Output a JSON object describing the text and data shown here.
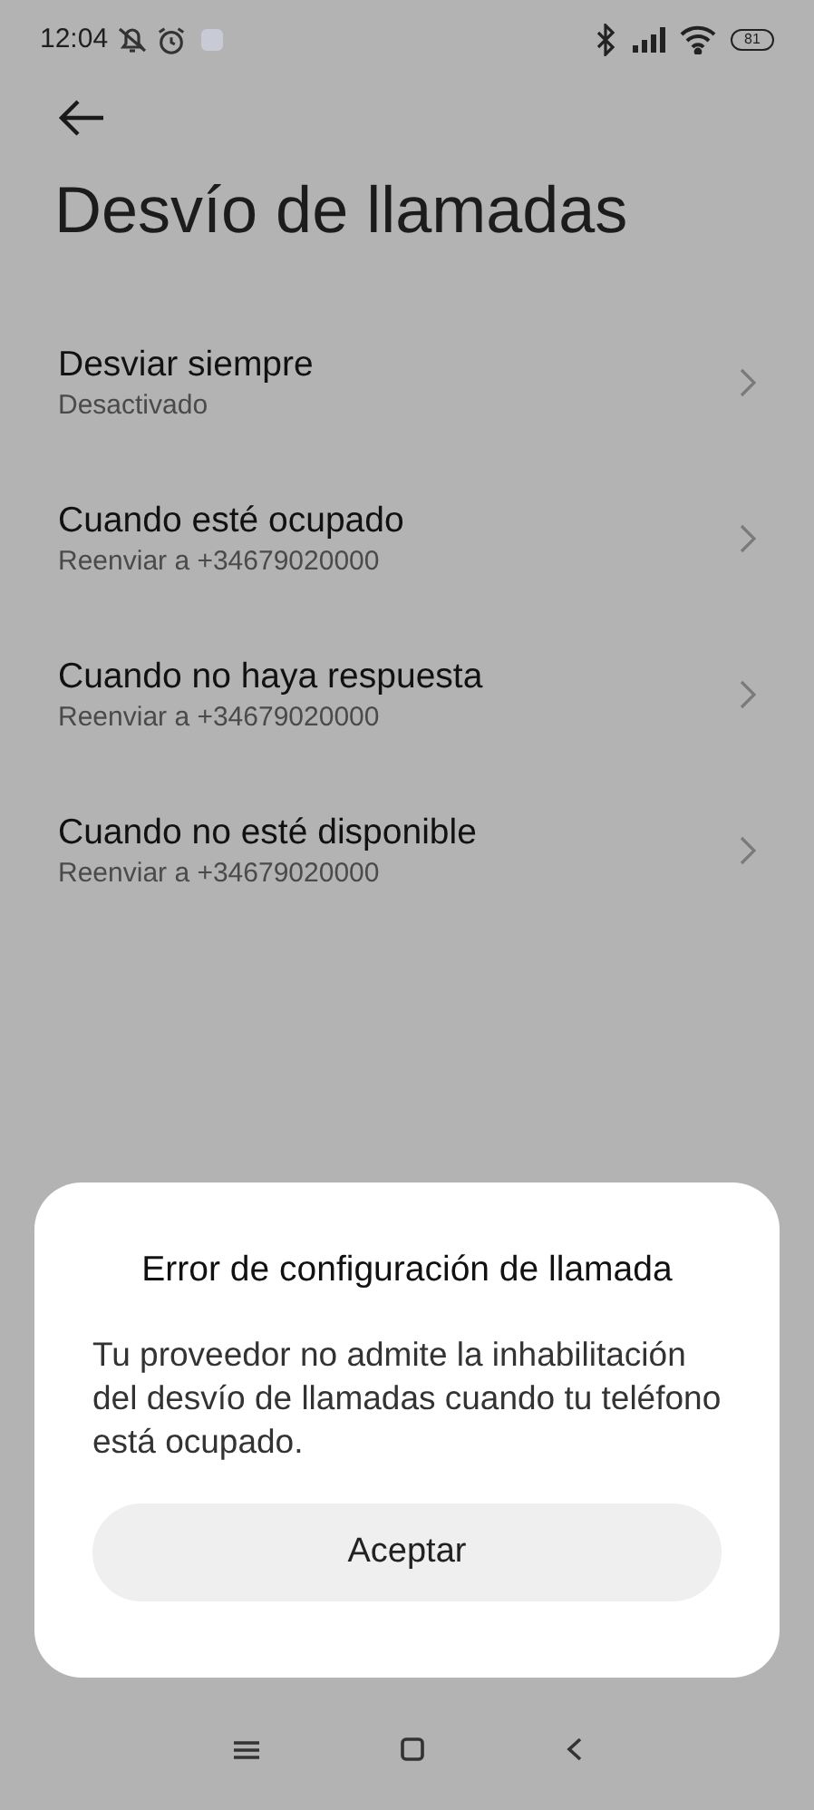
{
  "status_bar": {
    "time": "12:04",
    "battery": "81"
  },
  "title": "Desvío de llamadas",
  "items": [
    {
      "title": "Desviar siempre",
      "subtitle": "Desactivado"
    },
    {
      "title": "Cuando esté ocupado",
      "subtitle": "Reenviar a +34679020000"
    },
    {
      "title": "Cuando no haya respuesta",
      "subtitle": "Reenviar a +34679020000"
    },
    {
      "title": "Cuando no esté disponible",
      "subtitle": "Reenviar a +34679020000"
    }
  ],
  "dialog": {
    "title": "Error de configuración de llamada",
    "message": "Tu proveedor no admite la inhabilitación del desvío de llamadas cuando tu teléfono está ocupado.",
    "button": "Aceptar"
  }
}
